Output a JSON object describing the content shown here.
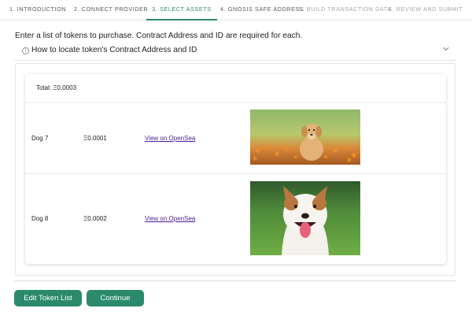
{
  "stepper": {
    "steps": [
      {
        "label": "1. INTRODUCTION"
      },
      {
        "label": "2. CONNECT PROVIDER"
      },
      {
        "label": "3. SELECT ASSETS"
      },
      {
        "label": "4. GNOSIS SAFE ADDRESS"
      },
      {
        "label": "5. BUILD TRANSACTION DATA"
      },
      {
        "label": "6. REVIEW AND SUBMIT"
      }
    ],
    "active_step": 3,
    "accent_color": "#2f8a6f"
  },
  "intro_text": "Enter a list of tokens to purchase. Contract Address and ID are required for each.",
  "locate": {
    "label": "How to locate token's Contract Address and ID",
    "icon": "info-icon",
    "toggle_icon": "chevron-down-icon"
  },
  "summary": {
    "total_label": "Total: Ξ0.0003"
  },
  "tokens": [
    {
      "name": "Dog 7",
      "price": "Ξ0.0001",
      "link_text": "View on OpenSea",
      "image": "puppy-in-flower-field-photo"
    },
    {
      "name": "Dog 8",
      "price": "Ξ0.0002",
      "link_text": "View on OpenSea",
      "image": "smiling-dog-on-grass-photo"
    }
  ],
  "buttons": {
    "edit": "Edit Token List",
    "continue": "Continue",
    "color": "#2b8a6c"
  }
}
